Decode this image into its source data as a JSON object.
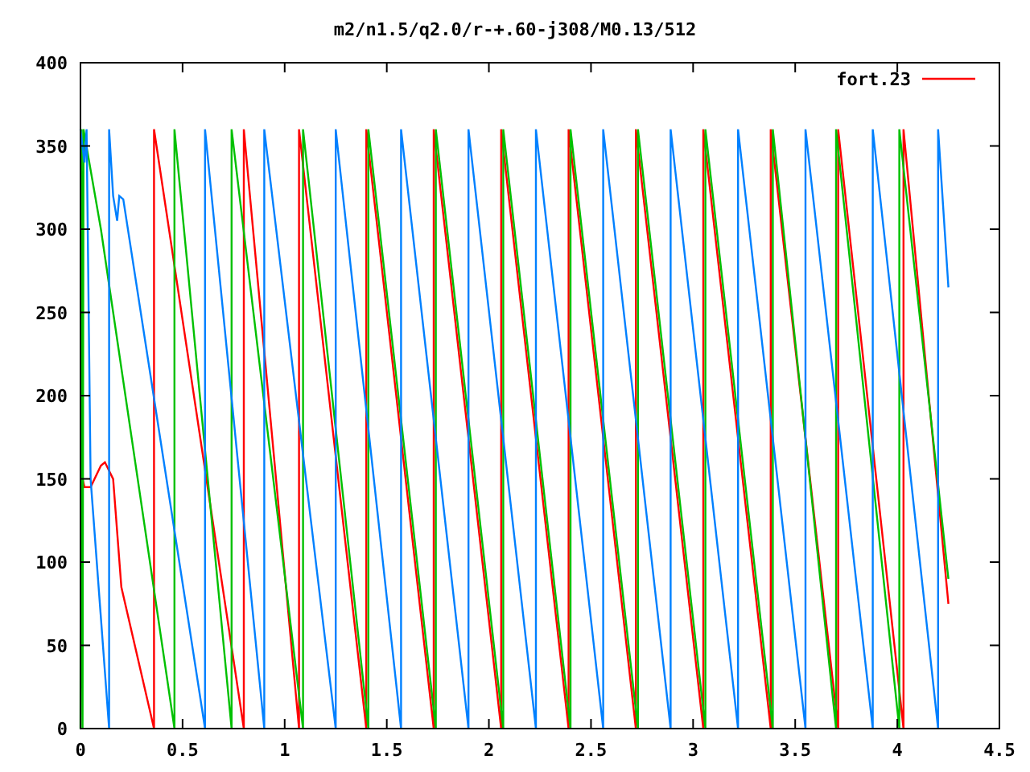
{
  "chart": {
    "chart_data": {
      "type": "line",
      "title": "m2/n1.5/q2.0/r-+.60-j308/M0.13/512",
      "xlim": [
        0,
        4.5
      ],
      "ylim": [
        0,
        400
      ],
      "xticks": [
        0,
        0.5,
        1,
        1.5,
        2,
        2.5,
        3,
        3.5,
        4,
        4.5
      ],
      "yticks": [
        0,
        50,
        100,
        150,
        200,
        250,
        300,
        350,
        400
      ],
      "series": [
        {
          "name": "fort.23",
          "color": "#ff0000",
          "x": [
            0.01,
            0.02,
            0.05,
            0.1,
            0.12,
            0.16,
            0.2,
            0.36,
            0.36,
            0.8,
            0.8,
            1.07,
            1.07,
            1.4,
            1.4,
            1.73,
            1.73,
            2.06,
            2.06,
            2.39,
            2.39,
            2.72,
            2.72,
            3.05,
            3.05,
            3.38,
            3.38,
            3.71,
            3.71,
            4.03,
            4.03,
            4.25
          ],
          "values": [
            150,
            145,
            145,
            158,
            160,
            150,
            85,
            0,
            360,
            0,
            360,
            0,
            360,
            0,
            360,
            0,
            360,
            0,
            360,
            0,
            360,
            0,
            360,
            0,
            360,
            0,
            360,
            0,
            360,
            0,
            360,
            75
          ]
        },
        {
          "color": "#00c000",
          "x": [
            0,
            0.005,
            0.01,
            0.015,
            0.1,
            0.46,
            0.46,
            0.74,
            0.74,
            1.09,
            1.09,
            1.41,
            1.41,
            1.74,
            1.74,
            2.07,
            2.07,
            2.4,
            2.4,
            2.73,
            2.73,
            3.06,
            3.06,
            3.39,
            3.39,
            3.7,
            3.7,
            4.01,
            4.01,
            4.25
          ],
          "values": [
            0,
            360,
            0,
            360,
            300,
            0,
            360,
            0,
            360,
            0,
            360,
            0,
            360,
            0,
            360,
            0,
            360,
            0,
            360,
            0,
            360,
            0,
            360,
            0,
            360,
            0,
            360,
            0,
            360,
            90
          ]
        },
        {
          "color": "#0080ff",
          "x": [
            0,
            0.02,
            0.03,
            0.05,
            0.14,
            0.14,
            0.16,
            0.18,
            0.19,
            0.21,
            0.61,
            0.61,
            0.9,
            0.9,
            1.25,
            1.25,
            1.57,
            1.57,
            1.9,
            1.9,
            2.23,
            2.23,
            2.56,
            2.56,
            2.89,
            2.89,
            3.22,
            3.22,
            3.55,
            3.55,
            3.88,
            3.88,
            4.2,
            4.2,
            4.25
          ],
          "values": [
            360,
            340,
            360,
            150,
            0,
            360,
            320,
            305,
            320,
            318,
            0,
            360,
            0,
            360,
            0,
            360,
            0,
            360,
            0,
            360,
            0,
            360,
            0,
            360,
            0,
            360,
            0,
            360,
            0,
            360,
            0,
            360,
            0,
            360,
            265
          ]
        }
      ]
    }
  }
}
